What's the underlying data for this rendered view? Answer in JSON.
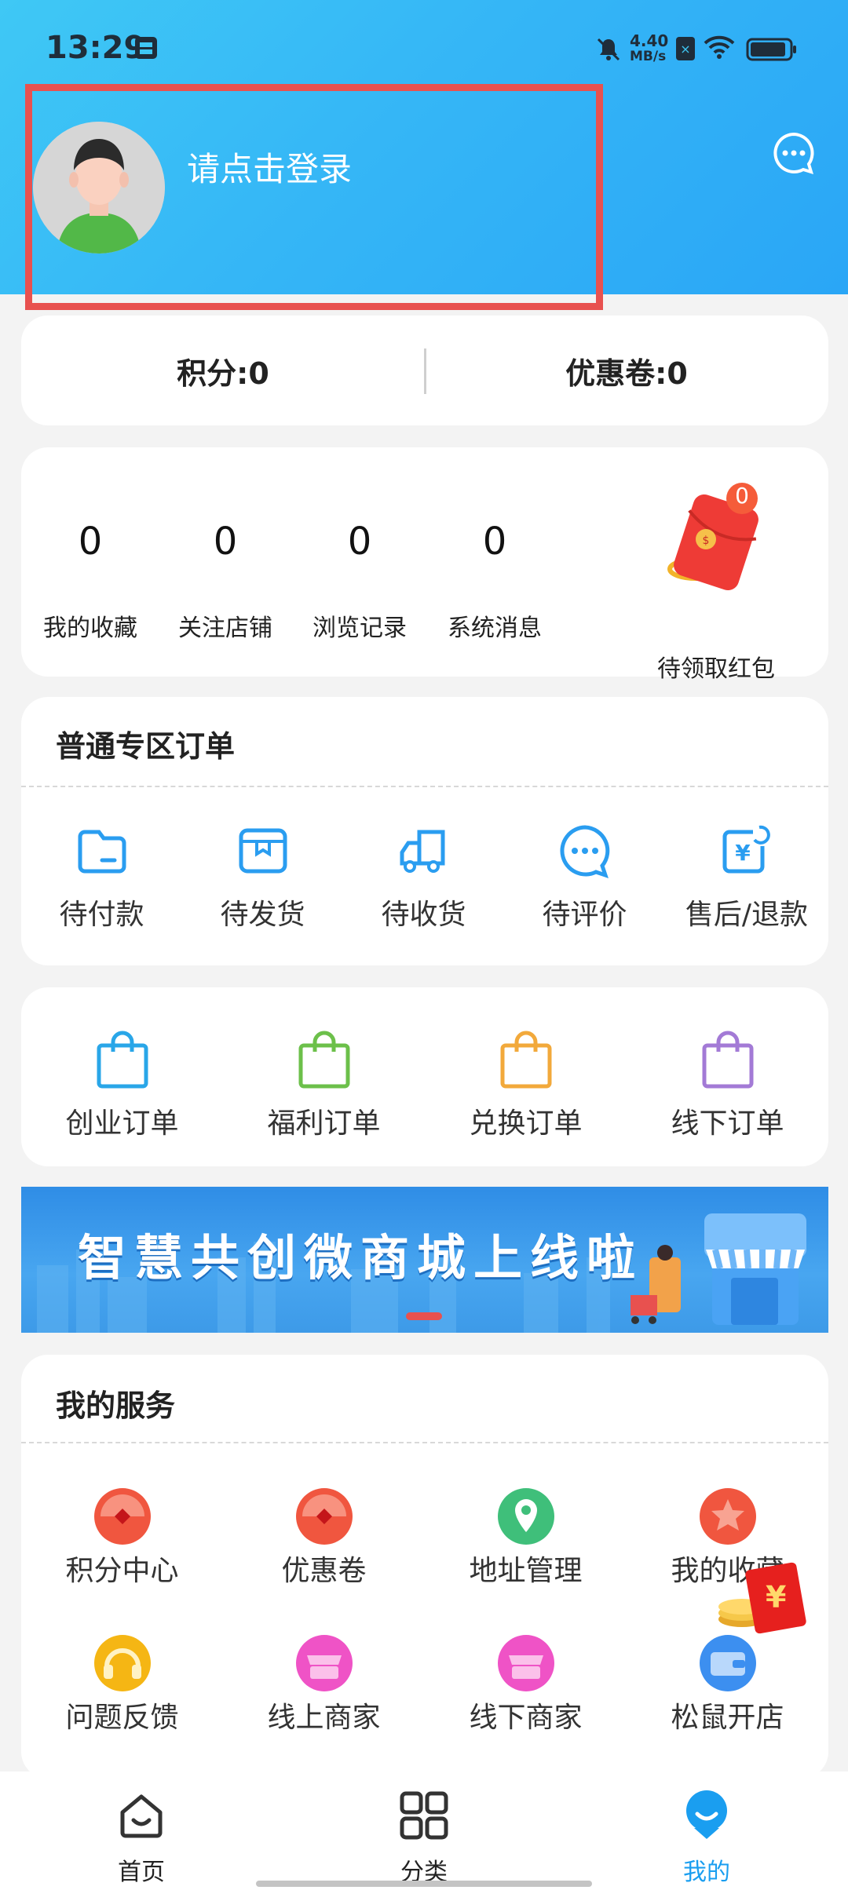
{
  "status_bar": {
    "time": "13:29",
    "net_speed_value": "4.40",
    "net_speed_unit": "MB/s"
  },
  "header": {
    "login_prompt": "请点击登录"
  },
  "points_bar": {
    "points": "积分:0",
    "coupons": "优惠卷:0"
  },
  "stats": [
    {
      "value": "0",
      "label": "我的收藏"
    },
    {
      "value": "0",
      "label": "关注店铺"
    },
    {
      "value": "0",
      "label": "浏览记录"
    },
    {
      "value": "0",
      "label": "系统消息"
    }
  ],
  "red_packet": {
    "badge": "0",
    "label": "待领取红包"
  },
  "orders": {
    "title": "普通专区订单",
    "items": [
      {
        "label": "待付款",
        "icon": "wallet-icon"
      },
      {
        "label": "待发货",
        "icon": "package-icon"
      },
      {
        "label": "待收货",
        "icon": "truck-icon"
      },
      {
        "label": "待评价",
        "icon": "chat-icon"
      },
      {
        "label": "售后/退款",
        "icon": "refund-icon"
      }
    ]
  },
  "special_orders": [
    {
      "label": "创业订单",
      "color": "#29a6e8"
    },
    {
      "label": "福利订单",
      "color": "#6cc04a"
    },
    {
      "label": "兑换订单",
      "color": "#f2a93b"
    },
    {
      "label": "线下订单",
      "color": "#a37ad6"
    }
  ],
  "banner": {
    "text": "智慧共创微商城上线啦"
  },
  "services": {
    "title": "我的服务",
    "items": [
      {
        "label": "积分中心",
        "color": "#f0563f",
        "icon": "points-center-icon"
      },
      {
        "label": "优惠卷",
        "color": "#f0563f",
        "icon": "coupon-icon"
      },
      {
        "label": "地址管理",
        "color": "#3fbf7a",
        "icon": "location-icon"
      },
      {
        "label": "我的收藏",
        "color": "#f0563f",
        "icon": "star-icon"
      },
      {
        "label": "问题反馈",
        "color": "#f5b614",
        "icon": "headset-icon"
      },
      {
        "label": "线上商家",
        "color": "#ef53c6",
        "icon": "online-shop-icon"
      },
      {
        "label": "线下商家",
        "color": "#ef53c6",
        "icon": "offline-shop-icon"
      },
      {
        "label": "松鼠开店",
        "color": "#3c8ff0",
        "icon": "wallet-card-icon"
      }
    ]
  },
  "floating_redpacket": {
    "symbol": "¥"
  },
  "bottom_nav": [
    {
      "label": "首页",
      "active": false
    },
    {
      "label": "分类",
      "active": false
    },
    {
      "label": "我的",
      "active": true
    }
  ],
  "colors": {
    "accent": "#1a9ef0",
    "header": "#35b6f6",
    "highlight": "#e8514f"
  }
}
